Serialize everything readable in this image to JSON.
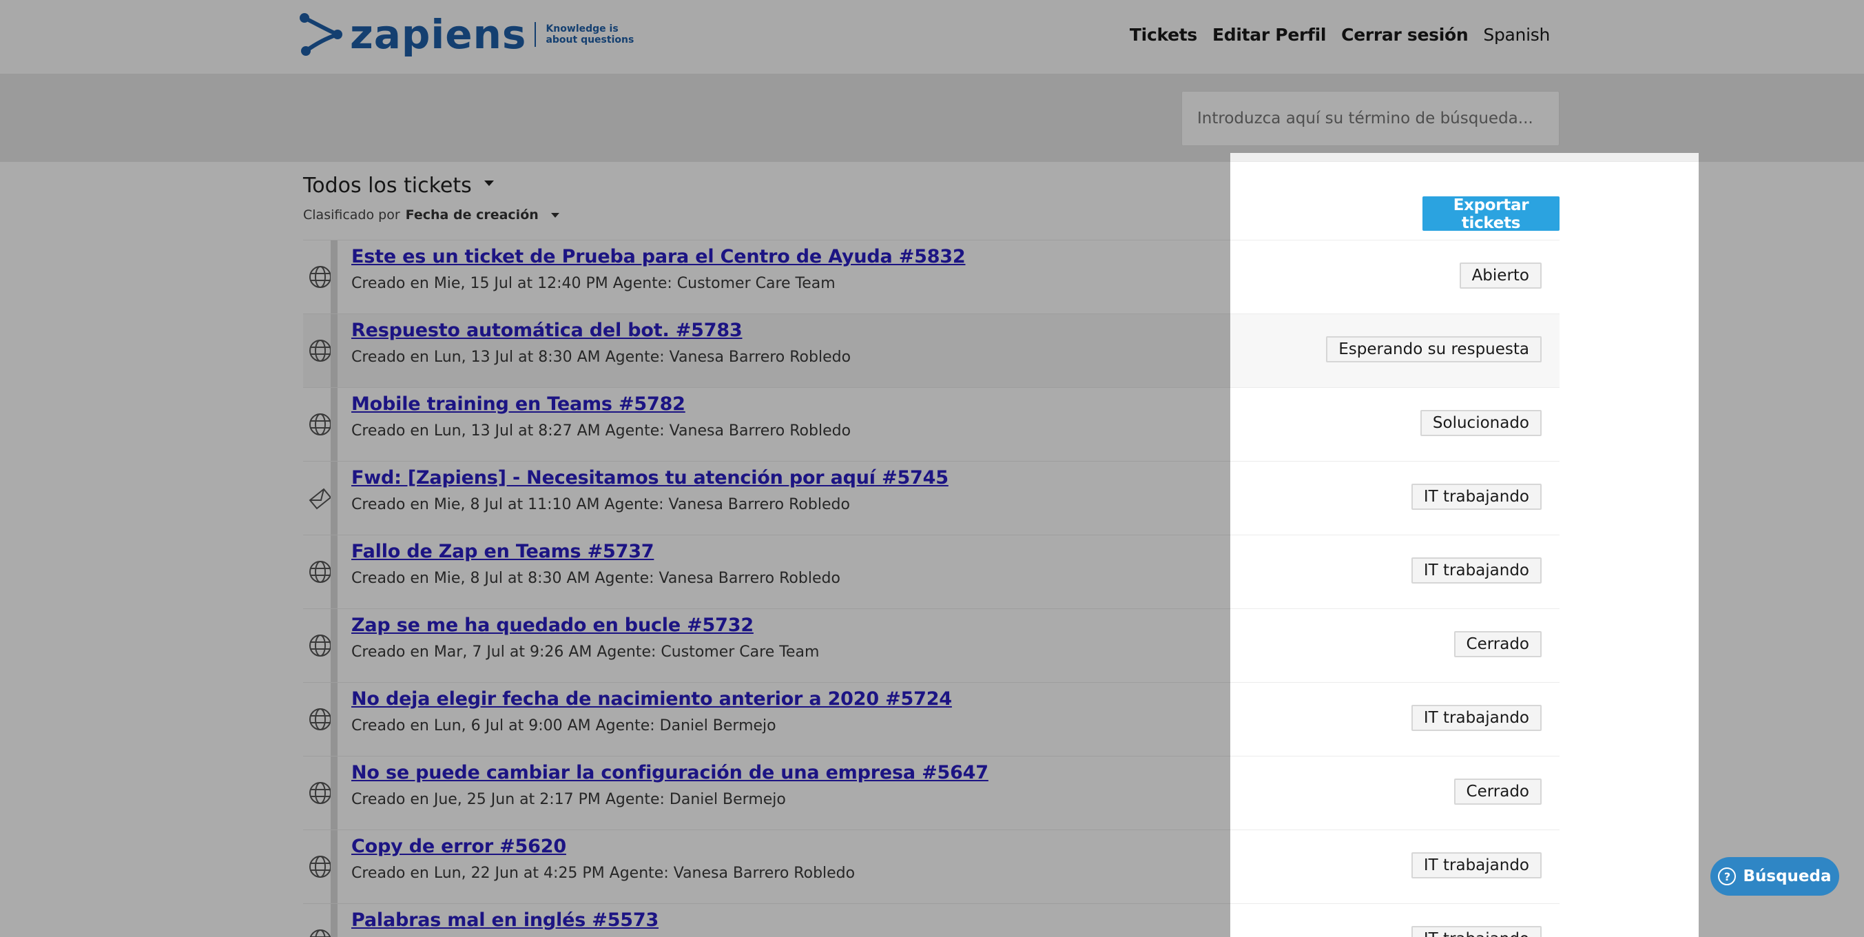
{
  "header": {
    "logo_word": "zapiens",
    "logo_tagline_line1": "Knowledge is",
    "logo_tagline_line2": "about questions",
    "nav": [
      "Tickets",
      "Editar Perfil",
      "Cerrar sesión"
    ],
    "language": "Spanish"
  },
  "search": {
    "placeholder": "Introduzca aquí su término de búsqueda..."
  },
  "list": {
    "title": "Todos los tickets",
    "sort_prefix": "Clasificado por",
    "sort_value": "Fecha de creación",
    "export_label": "Exportar tickets"
  },
  "tickets": [
    {
      "title": "Este es un ticket de Prueba para el Centro de Ayuda #5832",
      "meta": "Creado en Mie, 15 Jul at 12:40 PM Agente: Customer Care Team",
      "status": "Abierto",
      "icon": "globe-icon"
    },
    {
      "title": "Respuesto automática del bot. #5783",
      "meta": "Creado en Lun, 13 Jul at 8:30 AM Agente: Vanesa Barrero Robledo",
      "status": "Esperando su respuesta",
      "icon": "globe-icon"
    },
    {
      "title": "Mobile training en Teams #5782",
      "meta": "Creado en Lun, 13 Jul at 8:27 AM Agente: Vanesa Barrero Robledo",
      "status": "Solucionado",
      "icon": "globe-icon"
    },
    {
      "title": "Fwd: [Zapiens] - Necesitamos tu atención por aquí #5745",
      "meta": "Creado en Mie, 8 Jul at 11:10 AM Agente: Vanesa Barrero Robledo",
      "status": "IT trabajando",
      "icon": "envelope-icon"
    },
    {
      "title": "Fallo de Zap en Teams #5737",
      "meta": "Creado en Mie, 8 Jul at 8:30 AM Agente: Vanesa Barrero Robledo",
      "status": "IT trabajando",
      "icon": "globe-icon"
    },
    {
      "title": "Zap se me ha quedado en bucle #5732",
      "meta": "Creado en Mar, 7 Jul at 9:26 AM Agente: Customer Care Team",
      "status": "Cerrado",
      "icon": "globe-icon"
    },
    {
      "title": "No deja elegir fecha de nacimiento anterior a 2020 #5724",
      "meta": "Creado en Lun, 6 Jul at 9:00 AM Agente: Daniel Bermejo",
      "status": "IT trabajando",
      "icon": "globe-icon"
    },
    {
      "title": "No se puede cambiar la configuración de una empresa #5647",
      "meta": "Creado en Jue, 25 Jun at 2:17 PM Agente: Daniel Bermejo",
      "status": "Cerrado",
      "icon": "globe-icon"
    },
    {
      "title": "Copy de error #5620",
      "meta": "Creado en Lun, 22 Jun at 4:25 PM Agente: Vanesa Barrero Robledo",
      "status": "IT trabajando",
      "icon": "globe-icon"
    },
    {
      "title": "Palabras mal en inglés #5573",
      "meta": "",
      "status": "IT trabajando",
      "icon": "globe-icon"
    }
  ],
  "help": {
    "label": "Búsqueda"
  },
  "colors": {
    "link": "#2a1fc4",
    "export": "#2ba3e0",
    "help": "#2f86c5",
    "brand": "#1f5fa8"
  }
}
